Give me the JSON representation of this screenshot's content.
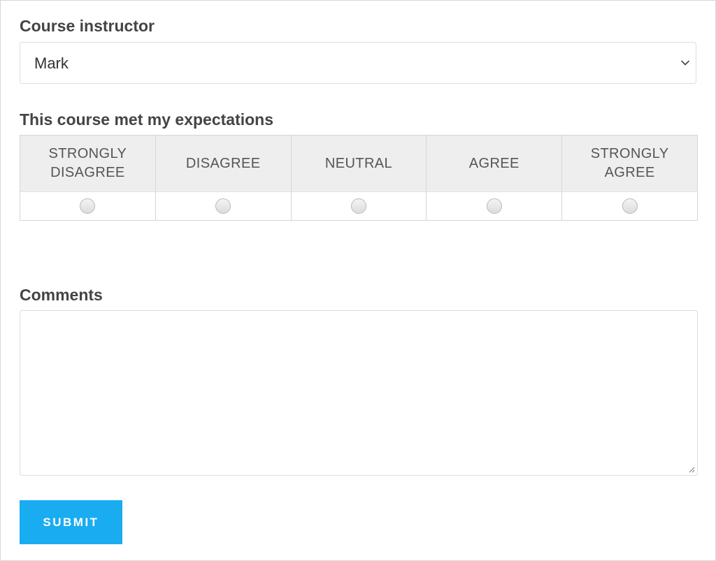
{
  "instructor": {
    "label": "Course instructor",
    "selected": "Mark",
    "icon": "chevron-down-icon"
  },
  "expectations": {
    "label": "This course met my expectations",
    "options": [
      "STRONGLY\nDISAGREE",
      "DISAGREE",
      "NEUTRAL",
      "AGREE",
      "STRONGLY\nAGREE"
    ]
  },
  "comments": {
    "label": "Comments",
    "value": ""
  },
  "submit": {
    "label": "SUBMIT",
    "color": "#1aacf0"
  }
}
